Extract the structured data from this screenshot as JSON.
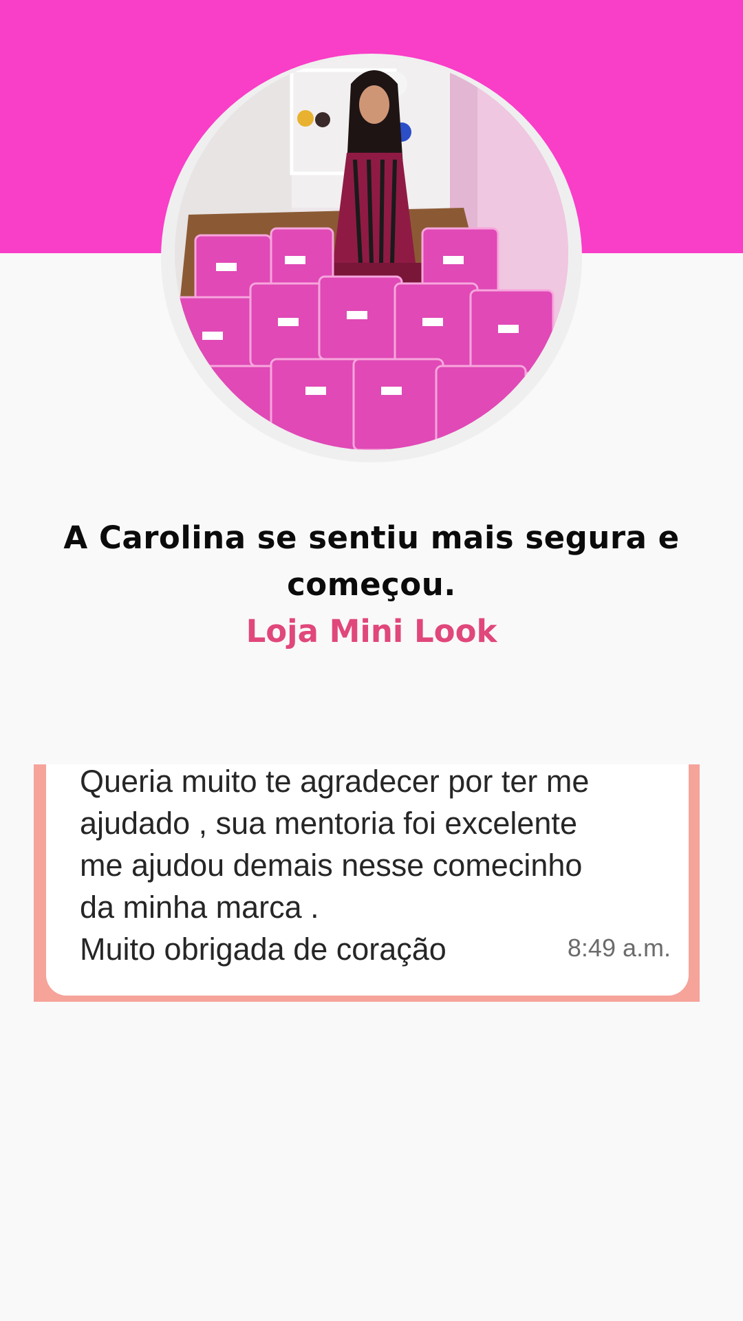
{
  "colors": {
    "banner": "#f93ec8",
    "accent": "#e0477b",
    "chat_frame": "#f6a39a"
  },
  "profile": {
    "photo": "woman-seated-among-pink-gift-bags-photo"
  },
  "headline": "A Carolina se sentiu mais segura e começou.",
  "store_name": "Loja Mini Look",
  "testimonial": {
    "message": "Queria muito te agradecer por ter me\najudado , sua mentoria foi excelente\nme ajudou demais nesse comecinho\nda minha marca .\nMuito obrigada de coração",
    "time": "8:49 a.m."
  }
}
